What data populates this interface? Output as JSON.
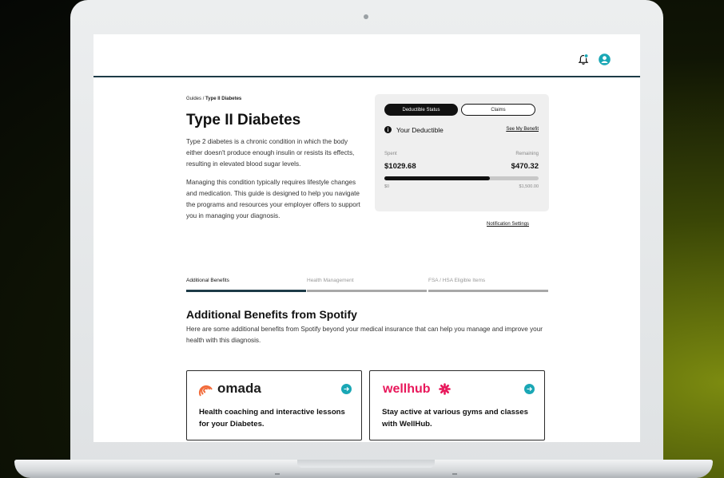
{
  "header": {
    "bell_icon": "bell-icon",
    "user_icon": "user-icon",
    "accent_color": "#1aa7b5"
  },
  "breadcrumb": {
    "parent": "Guides",
    "separator": "/",
    "current": "Type II Diabetes"
  },
  "page": {
    "title": "Type II Diabetes",
    "paragraphs": [
      "Type 2 diabetes is a chronic condition in which the body either doesn't produce enough insulin or resists its effects, resulting in elevated blood sugar levels.",
      "Managing this condition typically requires lifestyle changes and medication. This guide is designed to help you navigate the programs and resources your employer offers to support you in managing your diagnosis."
    ]
  },
  "deductible": {
    "tabs": [
      "Deductible Status",
      "Claims"
    ],
    "active_tab": "Deductible Status",
    "title": "Your Deductible",
    "link": "See My Benefit",
    "spent_label": "Spent",
    "remaining_label": "Remaining",
    "spent": "$1029.68",
    "remaining": "$470.32",
    "progress_fraction": 0.686,
    "min_label": "$0",
    "max_label": "$1,500.00"
  },
  "notification_link": "Notification Settings",
  "tabs": [
    {
      "label": "Additional Benefits",
      "active": true
    },
    {
      "label": "Health Management",
      "active": false
    },
    {
      "label": "FSA / HSA Eligible Items",
      "active": false
    }
  ],
  "benefits": {
    "title": "Additional Benefits from Spotify",
    "description": "Here are some additional benefits from Spotify beyond your medical insurance that can help you manage and improve your health with this diagnosis.",
    "cards": [
      {
        "brand": "omada",
        "brand_color": "#f26b3a",
        "text": "Health coaching and interactive lessons for your Diabetes."
      },
      {
        "brand": "wellhub",
        "brand_color": "#e8185b",
        "text": "Stay active at various gyms and classes with WellHub."
      }
    ]
  }
}
